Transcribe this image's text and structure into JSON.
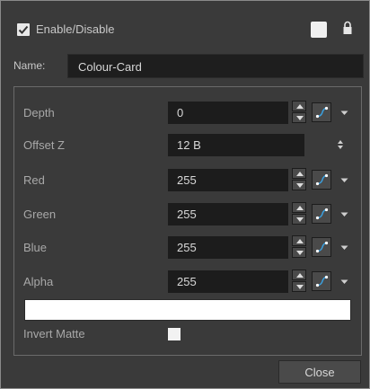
{
  "header": {
    "enable_label": "Enable/Disable",
    "enable_checked": true
  },
  "name": {
    "label": "Name:",
    "value": "Colour-Card"
  },
  "fields": [
    {
      "label": "Depth",
      "value": "0"
    },
    {
      "label": "Offset Z",
      "value": "12 B"
    },
    {
      "label": "Red",
      "value": "255"
    },
    {
      "label": "Green",
      "value": "255"
    },
    {
      "label": "Blue",
      "value": "255"
    },
    {
      "label": "Alpha",
      "value": "255"
    }
  ],
  "colour_swatch": "#ffffff",
  "invert_matte": {
    "label": "Invert Matte",
    "checked": false
  },
  "footer": {
    "close_label": "Close"
  },
  "icons": {
    "enable_checkbox": "checkmark-icon",
    "lock": "lock-icon",
    "spinner": "spin-arrows-icon",
    "function": "function-curve-icon",
    "menu": "caret-down-icon"
  }
}
